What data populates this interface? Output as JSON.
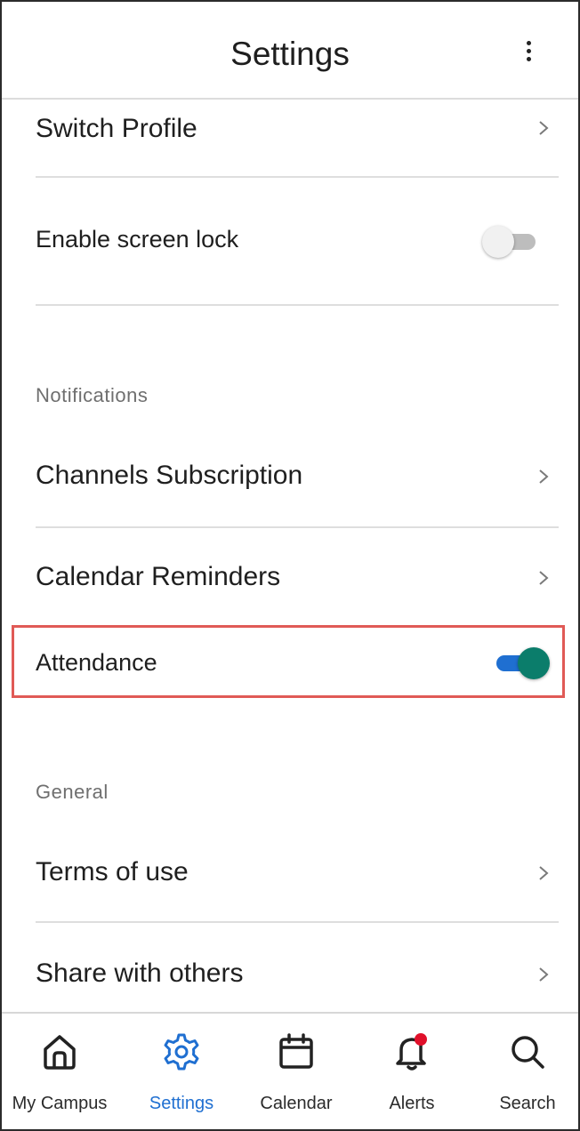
{
  "header": {
    "title": "Settings",
    "menu_icon": "more-vertical-icon"
  },
  "rows": {
    "switch_profile": {
      "label": "Switch Profile"
    },
    "screen_lock": {
      "label": "Enable screen lock",
      "enabled": false
    },
    "channels": {
      "label": "Channels Subscription"
    },
    "calendar_reminders": {
      "label": "Calendar Reminders"
    },
    "attendance": {
      "label": "Attendance",
      "enabled": true
    },
    "terms": {
      "label": "Terms of use"
    },
    "share": {
      "label": "Share with others"
    }
  },
  "sections": {
    "notifications": "Notifications",
    "general": "General"
  },
  "nav": [
    {
      "label": "My Campus",
      "icon": "home-icon",
      "active": false
    },
    {
      "label": "Settings",
      "icon": "gear-icon",
      "active": true
    },
    {
      "label": "Calendar",
      "icon": "calendar-icon",
      "active": false
    },
    {
      "label": "Alerts",
      "icon": "bell-icon",
      "active": false,
      "badge": true
    },
    {
      "label": "Search",
      "icon": "search-icon",
      "active": false
    }
  ],
  "colors": {
    "accent": "#1f6fd1",
    "toggle_thumb_on": "#0b7d6b",
    "highlight_border": "#e05a56",
    "badge": "#e0102a"
  }
}
